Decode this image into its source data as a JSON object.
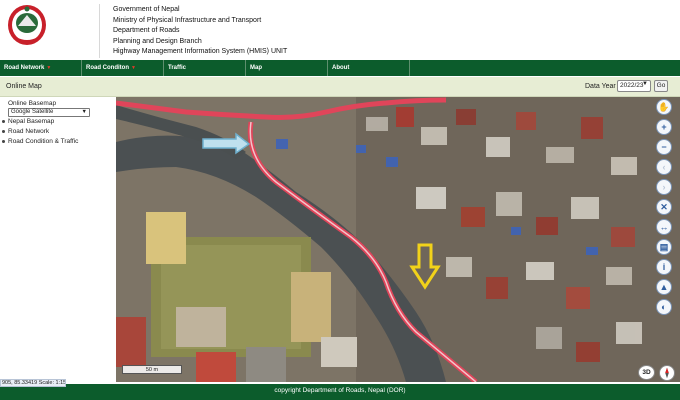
{
  "header": {
    "lines": [
      "Government of Nepal",
      "Ministry of Physical Infrastructure and Transport",
      "Department of Roads",
      "Planning and Design Branch",
      "Highway Management Information System (HMIS) UNIT"
    ]
  },
  "nav": {
    "items": [
      {
        "label": "Road Network",
        "has_dropdown": true
      },
      {
        "label": "Road Conditon",
        "has_dropdown": true
      },
      {
        "label": "Traffic",
        "has_dropdown": false
      },
      {
        "label": "Map",
        "has_dropdown": false
      },
      {
        "label": "About",
        "has_dropdown": false
      }
    ]
  },
  "subbar": {
    "title": "Online Map",
    "data_year_label": "Data Year",
    "data_year_value": "2022/23",
    "go_label": "Go"
  },
  "sidebar": {
    "basemap_label": "Online Basemap",
    "basemap_value": "Google Satellite",
    "items": [
      "Nepal Basemap",
      "Road Network",
      "Road Condition & Traffic"
    ]
  },
  "map": {
    "scale_label": "50 m",
    "btn_3d": "3D",
    "tools": [
      "hand-icon",
      "zoom-in-icon",
      "zoom-out-icon",
      "back-arrow-icon",
      "forward-arrow-icon",
      "tools-icon",
      "measure-icon",
      "print-icon",
      "info-icon",
      "road-icon",
      "globe-icon"
    ]
  },
  "status": {
    "coords": "905, 85.33419  Scale: 1:15"
  },
  "footer": {
    "text": "copyright Department of Roads, Nepal (DOR)"
  },
  "colors": {
    "nav_green": "#0c5c2c",
    "subbar_bg": "#e7edd4",
    "road_red": "#e0455a",
    "arrow_blue": "#7fc4e0",
    "arrow_yellow": "#f2d21a"
  }
}
